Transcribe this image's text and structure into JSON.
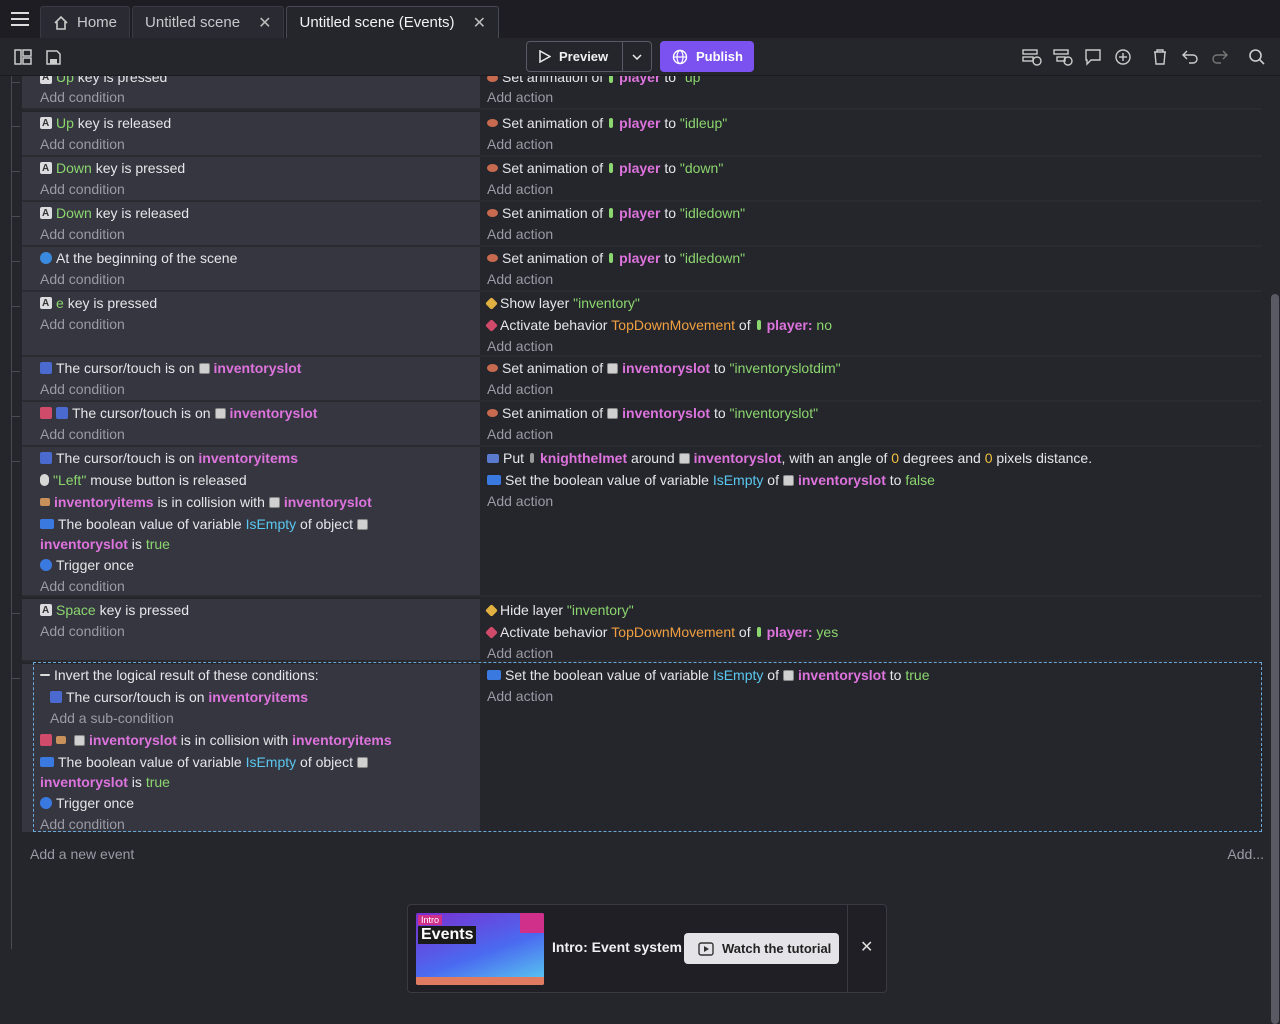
{
  "tabs": [
    {
      "label": "Home"
    },
    {
      "label": "Untitled scene"
    },
    {
      "label": "Untitled scene (Events)"
    }
  ],
  "toolbar": {
    "preview_label": "Preview",
    "publish_label": "Publish"
  },
  "events": {
    "add_condition": "Add condition",
    "add_action": "Add action",
    "add_subcondition": "Add a sub-condition",
    "add_new_event": "Add a new event",
    "add_menu": "Add..."
  },
  "text": {
    "up": "Up",
    "down": "Down",
    "e": "e",
    "space": "Space",
    "key_pressed": "key is pressed",
    "key_released": "key is released",
    "set_anim": "Set animation of",
    "player": "player",
    "to": "to",
    "anim_up": "\"up\"",
    "anim_idleup": "\"idleup\"",
    "anim_down": "\"down\"",
    "anim_idledown": "\"idledown\"",
    "anim_slotdim": "\"inventoryslotdim\"",
    "anim_slot": "\"inventoryslot\"",
    "scene_begin": "At the beginning of the scene",
    "show_layer": "Show layer",
    "hide_layer": "Hide layer",
    "layer_inventory": "\"inventory\"",
    "activate_behavior": "Activate behavior",
    "topdown": "TopDownMovement",
    "of": "of",
    "player_no": "player:",
    "no": "no",
    "yes": "yes",
    "cursor_on": "The cursor/touch is on",
    "inventoryslot": "inventoryslot",
    "inventoryitems": "inventoryitems",
    "left_mouse": "\"Left\"",
    "mouse_released": "mouse button is released",
    "in_collision": "is in collision with",
    "bool_var": "The boolean value of variable",
    "isempty": "IsEmpty",
    "of_object": "of object",
    "is": "is",
    "true": "true",
    "false": "false",
    "trigger_once": "Trigger once",
    "put": "Put",
    "knighthelmet": "knighthelmet",
    "around": "around",
    "with_angle": ", with an angle of",
    "zero": "0",
    "degrees_and": "degrees and",
    "pixels_distance": "pixels distance.",
    "set_bool": "Set the boolean value of variable",
    "invert": "Invert the logical result of these conditions:"
  },
  "tutorial": {
    "thumb_tag": "Intro",
    "thumb_title": "Events",
    "title": "Intro: Event system",
    "watch_label": "Watch the tutorial"
  }
}
